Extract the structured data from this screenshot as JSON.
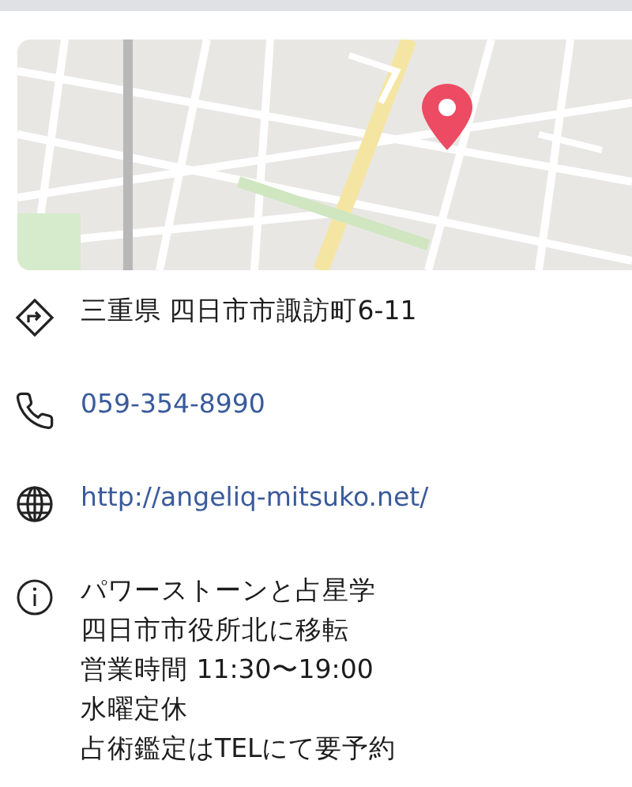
{
  "details": [
    {
      "kind": "address",
      "text": "三重県 四日市市諏訪町6-11"
    },
    {
      "kind": "phone",
      "text": "059-354-8990"
    },
    {
      "kind": "website",
      "text": "http://angeliq-mitsuko.net/"
    },
    {
      "kind": "info",
      "lines": [
        "パワーストーンと占星学",
        "四日市市役所北に移転",
        "営業時間 11:30〜19:00",
        "水曜定休",
        "占術鑑定はTELにて要予約"
      ]
    }
  ]
}
